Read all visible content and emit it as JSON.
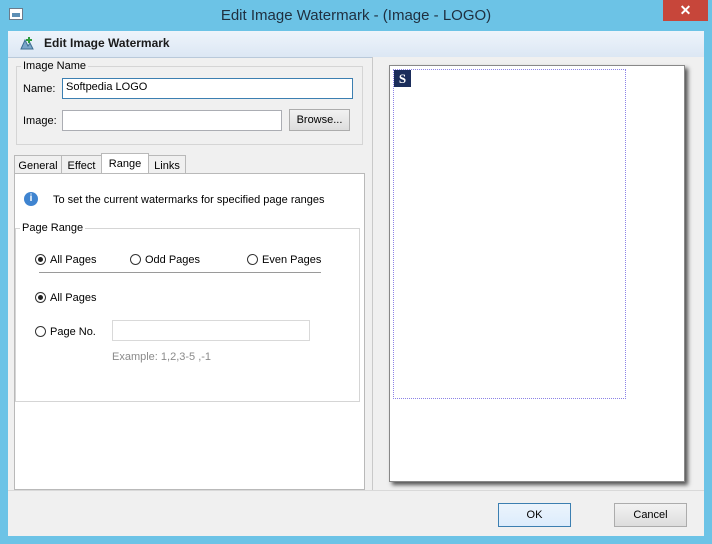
{
  "window": {
    "title": "Edit Image Watermark - (Image - LOGO)",
    "close_glyph": "✕"
  },
  "header": {
    "title": "Edit Image Watermark",
    "icon": "add-image-icon"
  },
  "image_name": {
    "group_label": "Image Name",
    "name_label": "Name:",
    "name_value": "Softpedia LOGO",
    "image_label": "Image:",
    "image_value": "",
    "browse_label": "Browse..."
  },
  "tabs": [
    {
      "label": "General",
      "active": false
    },
    {
      "label": "Effect",
      "active": false
    },
    {
      "label": "Range",
      "active": true
    },
    {
      "label": "Links",
      "active": false
    }
  ],
  "range": {
    "info_text": "To set the current watermarks for specified page ranges",
    "group_label": "Page Range",
    "subset_options": [
      {
        "label": "All Pages",
        "selected": true
      },
      {
        "label": "Odd Pages",
        "selected": false
      },
      {
        "label": "Even Pages",
        "selected": false
      }
    ],
    "all_pages_label": "All Pages",
    "page_no_label": "Page No.",
    "page_no_value": "",
    "example_text": "Example: 1,2,3-5 ,-1"
  },
  "preview": {
    "logo_letter": "S"
  },
  "footer": {
    "ok_label": "OK",
    "cancel_label": "Cancel"
  },
  "colors": {
    "frame": "#6cc3e6",
    "close": "#c7463a",
    "logo_bg": "#1b2d5b",
    "margin_line": "#8c83e6"
  }
}
